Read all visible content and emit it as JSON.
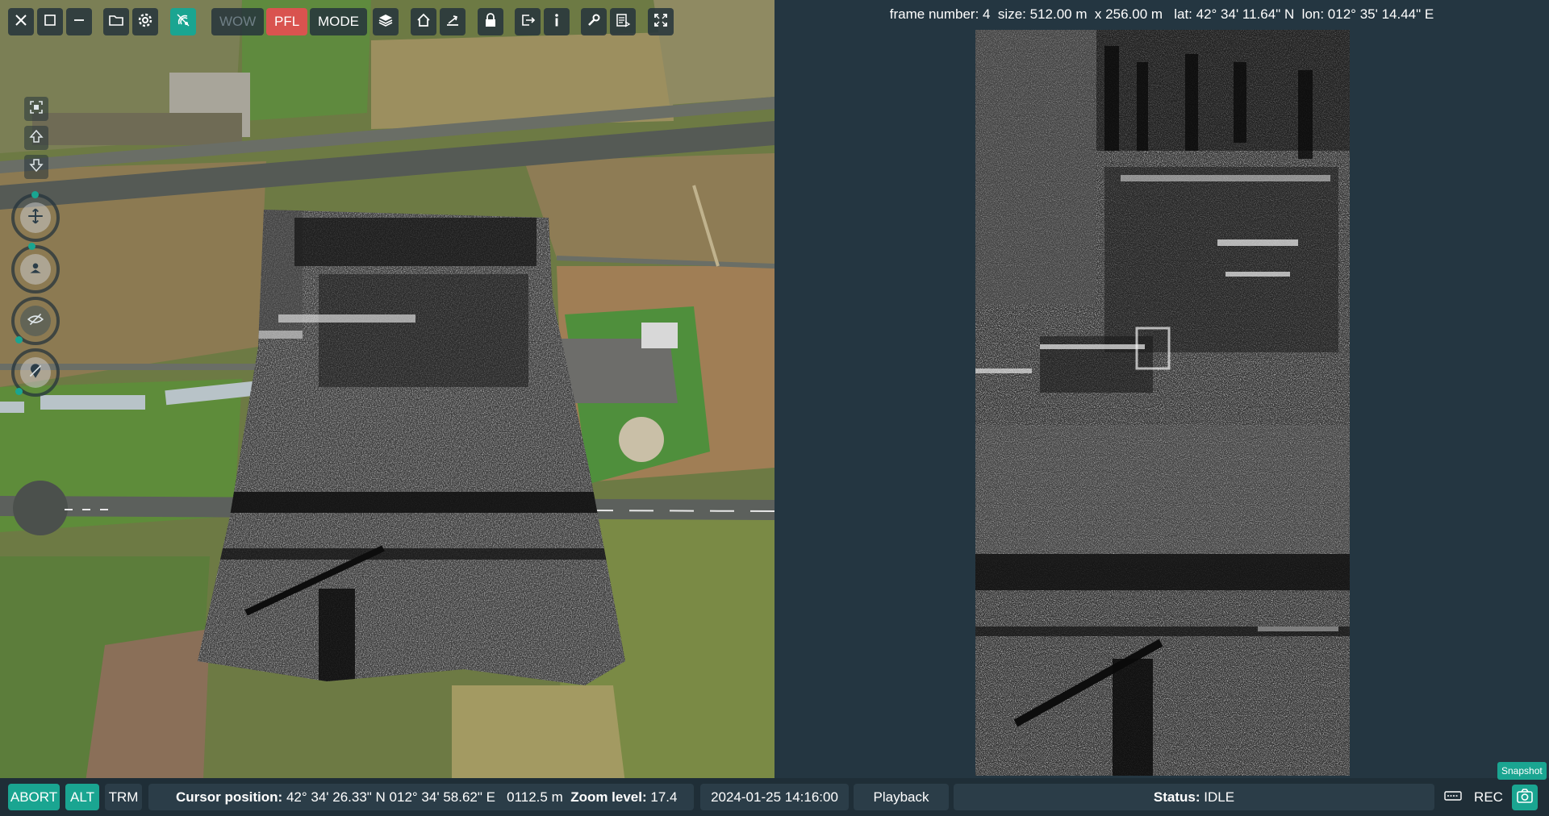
{
  "toolbar": {
    "close_icon": "close-icon",
    "maximize_icon": "window-maximize-icon",
    "minimize_icon": "window-minimize-icon",
    "open_icon": "folder-icon",
    "settings_icon": "gear-icon",
    "link_icon": "satellite-link-icon",
    "wow_label": "WOW",
    "pfl_label": "PFL",
    "mode_label": "MODE",
    "layers_icon": "layers-icon",
    "home_icon": "home-icon",
    "aircraft_icon": "aircraft-icon",
    "lock_icon": "lock-icon",
    "exit_icon": "exit-icon",
    "info_icon": "info-icon",
    "tools_icon": "wrench-icon",
    "report_icon": "report-icon",
    "fullscreen_icon": "fullscreen-icon",
    "active_color": "#1aa591",
    "alert_color": "#d9534f"
  },
  "side_controls": {
    "fit_icon": "fit-view-icon",
    "up_icon": "arrow-up-icon",
    "down_icon": "arrow-down-icon",
    "dials": [
      "move-drone-icon",
      "target-location-icon",
      "visibility-off-icon",
      "map-pin-icon"
    ]
  },
  "sar_panel": {
    "frame_info": "frame number: 4  size: 512.00 m  x 256.00 m   lat: 42° 34' 11.64\" N  lon: 012° 35' 14.44\" E"
  },
  "statusbar": {
    "abort_label": "ABORT",
    "alt_label": "ALT",
    "trm_label": "TRM",
    "cursor_label": "Cursor position:",
    "cursor_value": " 42° 34' 26.33\" N 012° 34' 58.62\" E   0112.5 m  ",
    "zoom_label": "Zoom level:",
    "zoom_value": " 17.4",
    "datetime": "2024-01-25 14:16:00",
    "playback_label": "Playback",
    "status_label": "Status:",
    "status_value": " IDLE",
    "keyboard_icon": "keyboard-icon",
    "rec_label": "REC",
    "snapshot_tooltip": "Snapshot",
    "camera_icon": "camera-icon"
  }
}
